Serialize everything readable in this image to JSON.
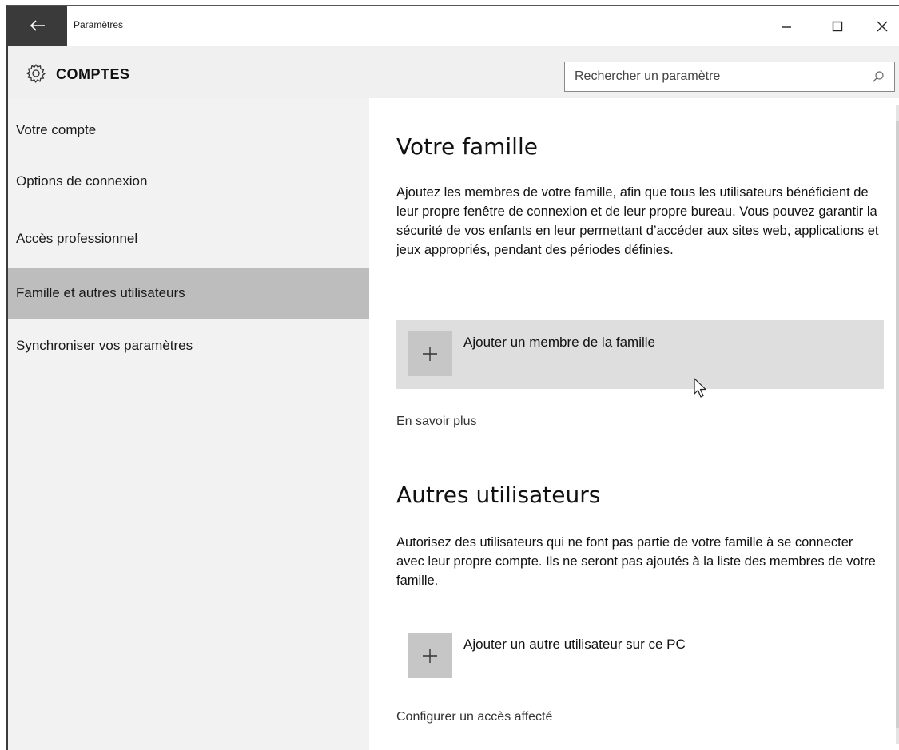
{
  "window": {
    "title": "Paramètres"
  },
  "header": {
    "title": "COMPTES",
    "search_placeholder": "Rechercher un paramètre"
  },
  "sidebar": {
    "items": [
      {
        "label": "Votre compte",
        "active": false
      },
      {
        "label": "Options de connexion",
        "active": false
      },
      {
        "label": "Accès professionnel",
        "active": false
      },
      {
        "label": "Famille et autres utilisateurs",
        "active": true
      },
      {
        "label": "Synchroniser vos paramètres",
        "active": false
      }
    ]
  },
  "main": {
    "family": {
      "heading": "Votre famille",
      "description": "Ajoutez les membres de votre famille, afin que tous les utilisateurs bénéficient de leur propre fenêtre de connexion et de leur propre bureau. Vous pouvez garantir la sécurité de vos enfants en leur permettant d’accéder aux sites web, applications et jeux appropriés, pendant des périodes définies.",
      "add_label": "Ajouter un membre de la famille",
      "learn_more": "En savoir plus"
    },
    "others": {
      "heading": "Autres utilisateurs",
      "description": "Autorisez des utilisateurs qui ne font pas partie de votre famille à se connecter avec leur propre compte. Ils ne seront pas ajoutés à la liste des membres de votre famille.",
      "add_label": "Ajouter un autre utilisateur sur ce PC",
      "assigned_access": "Configurer un accès affecté"
    }
  },
  "icons": {
    "back": "back-arrow-icon",
    "settings": "gear-icon",
    "search": "search-icon",
    "add": "plus-icon",
    "minimize": "minimize-icon",
    "maximize": "maximize-icon",
    "close": "close-icon"
  },
  "colors": {
    "titlebar_back": "#3a3a3a",
    "sidebar_bg": "#f2f2f2",
    "active_item": "#bdbdbd",
    "plus_tile": "#c6c6c6"
  }
}
